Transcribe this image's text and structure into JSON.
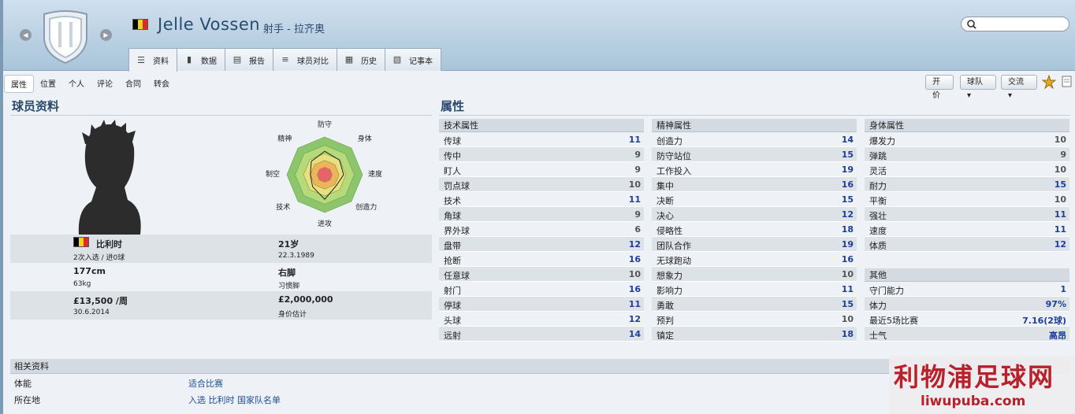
{
  "player": {
    "name": "Jelle Vossen",
    "role_club": "射手 - 拉齐奥",
    "flag_colors": [
      "#000000",
      "#f4d21e",
      "#e02a2a"
    ]
  },
  "tabs": [
    {
      "label": "资料",
      "icon": "profile-icon",
      "active": true
    },
    {
      "label": "数据",
      "icon": "stats-icon",
      "active": false
    },
    {
      "label": "报告",
      "icon": "report-icon",
      "active": false
    },
    {
      "label": "球员对比",
      "icon": "compare-icon",
      "active": false
    },
    {
      "label": "历史",
      "icon": "history-icon",
      "active": false
    },
    {
      "label": "记事本",
      "icon": "notebook-icon",
      "active": false
    }
  ],
  "subnav": [
    "属性",
    "位置",
    "个人",
    "评论",
    "合同",
    "转会"
  ],
  "toolbar": {
    "offer": "开价",
    "club": "球队",
    "interact": "交流"
  },
  "profile": {
    "heading": "球员资料",
    "nation": "比利时",
    "caps": "2次入选 / 进0球",
    "age": "21岁",
    "dob": "22.3.1989",
    "height": "177cm",
    "weight": "63kg",
    "foot": "右脚",
    "foot_label": "习惯脚",
    "wage": "£13,500 /周",
    "contract": "30.6.2014",
    "value": "£2,000,000",
    "value_label": "身价估计"
  },
  "radar_labels": [
    "防守",
    "身体",
    "速度",
    "创造力",
    "进攻",
    "技术",
    "制空",
    "精神"
  ],
  "attributes": {
    "heading": "属性",
    "technical": {
      "title": "技术属性",
      "rows": [
        {
          "name": "传球",
          "value": "11"
        },
        {
          "name": "传中",
          "value": "9"
        },
        {
          "name": "盯人",
          "value": "9"
        },
        {
          "name": "罚点球",
          "value": "10"
        },
        {
          "name": "技术",
          "value": "11"
        },
        {
          "name": "角球",
          "value": "9"
        },
        {
          "name": "界外球",
          "value": "6"
        },
        {
          "name": "盘带",
          "value": "12"
        },
        {
          "name": "抢断",
          "value": "16"
        },
        {
          "name": "任意球",
          "value": "10"
        },
        {
          "name": "射门",
          "value": "16"
        },
        {
          "name": "停球",
          "value": "11"
        },
        {
          "name": "头球",
          "value": "12"
        },
        {
          "name": "远射",
          "value": "14"
        }
      ]
    },
    "mental": {
      "title": "精神属性",
      "rows": [
        {
          "name": "创造力",
          "value": "14"
        },
        {
          "name": "防守站位",
          "value": "15"
        },
        {
          "name": "工作投入",
          "value": "19"
        },
        {
          "name": "集中",
          "value": "16"
        },
        {
          "name": "决断",
          "value": "15"
        },
        {
          "name": "决心",
          "value": "12"
        },
        {
          "name": "侵略性",
          "value": "18"
        },
        {
          "name": "团队合作",
          "value": "19"
        },
        {
          "name": "无球跑动",
          "value": "16"
        },
        {
          "name": "想象力",
          "value": "10"
        },
        {
          "name": "影响力",
          "value": "11"
        },
        {
          "name": "勇敢",
          "value": "15"
        },
        {
          "name": "预判",
          "value": "10"
        },
        {
          "name": "镇定",
          "value": "18"
        }
      ]
    },
    "physical": {
      "title": "身体属性",
      "rows": [
        {
          "name": "爆发力",
          "value": "10"
        },
        {
          "name": "弹跳",
          "value": "9"
        },
        {
          "name": "灵活",
          "value": "10"
        },
        {
          "name": "耐力",
          "value": "15"
        },
        {
          "name": "平衡",
          "value": "10"
        },
        {
          "name": "强壮",
          "value": "11"
        },
        {
          "name": "速度",
          "value": "11"
        },
        {
          "name": "体质",
          "value": "12"
        }
      ]
    },
    "other": {
      "title": "其他",
      "rows": [
        {
          "name": "守门能力",
          "value": "1"
        },
        {
          "name": "体力",
          "value": "97%"
        },
        {
          "name": "最近5场比赛",
          "value": "7.16(2球)"
        },
        {
          "name": "士气",
          "value": "高昂"
        }
      ]
    }
  },
  "related": {
    "title": "相关资料",
    "fitness_label": "体能",
    "fitness_value": "适合比赛",
    "location_label": "所在地",
    "location_value": "入选 比利时 国家队名单"
  },
  "watermark": {
    "title": "利物浦足球网",
    "url": "liwupuba.com"
  }
}
